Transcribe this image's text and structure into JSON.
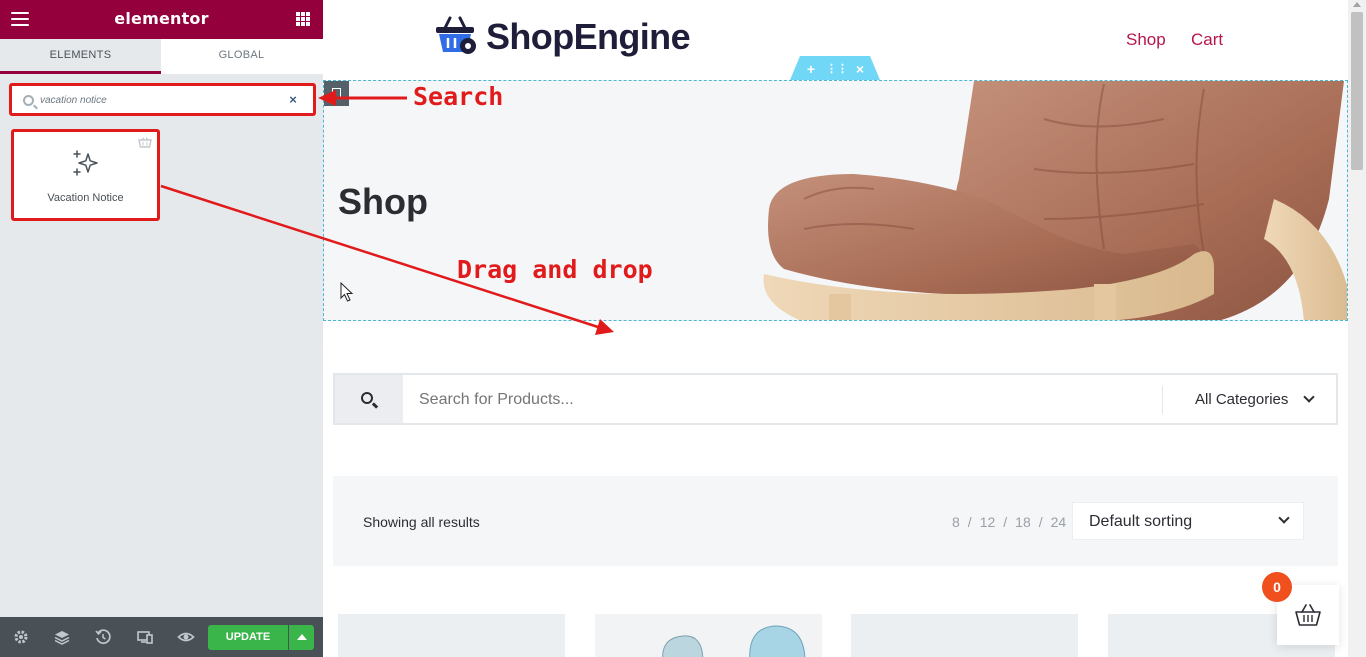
{
  "editor": {
    "brand": "elementor",
    "tabs": [
      {
        "label": "ELEMENTS"
      },
      {
        "label": "GLOBAL"
      }
    ],
    "search": {
      "value": "vacation notice",
      "clear_glyph": "×"
    },
    "widget": {
      "label": "Vacation Notice",
      "icon": "sparkles-icon"
    },
    "footer": {
      "icons": [
        "gear-icon",
        "layers-icon",
        "history-icon",
        "responsive-icon",
        "eye-icon"
      ],
      "update_label": "UPDATE"
    },
    "colors": {
      "header": "#93003c",
      "panel": "#e6e9ec",
      "footer": "#495157",
      "update": "#39b54a"
    }
  },
  "site": {
    "logo_text": "ShopEngine",
    "nav": [
      {
        "label": "Shop"
      },
      {
        "label": "Cart"
      }
    ],
    "section_handle": {
      "add": "+",
      "move": "⋮⋮",
      "delete": "×"
    },
    "hero_title": "Shop",
    "search": {
      "placeholder": "Search for Products...",
      "category": "All Categories"
    },
    "results_text": "Showing all results",
    "per_page": [
      "8",
      "12",
      "18",
      "24"
    ],
    "per_page_sep": "/",
    "sort_label": "Default sorting",
    "cart_count": "0",
    "colors": {
      "accent": "#b5174a",
      "cart_badge": "#f04f1e",
      "edit_outline": "#4ab7d3"
    }
  },
  "annotations": {
    "search": "Search",
    "drag": "Drag and drop",
    "color": "#e11b1b"
  }
}
